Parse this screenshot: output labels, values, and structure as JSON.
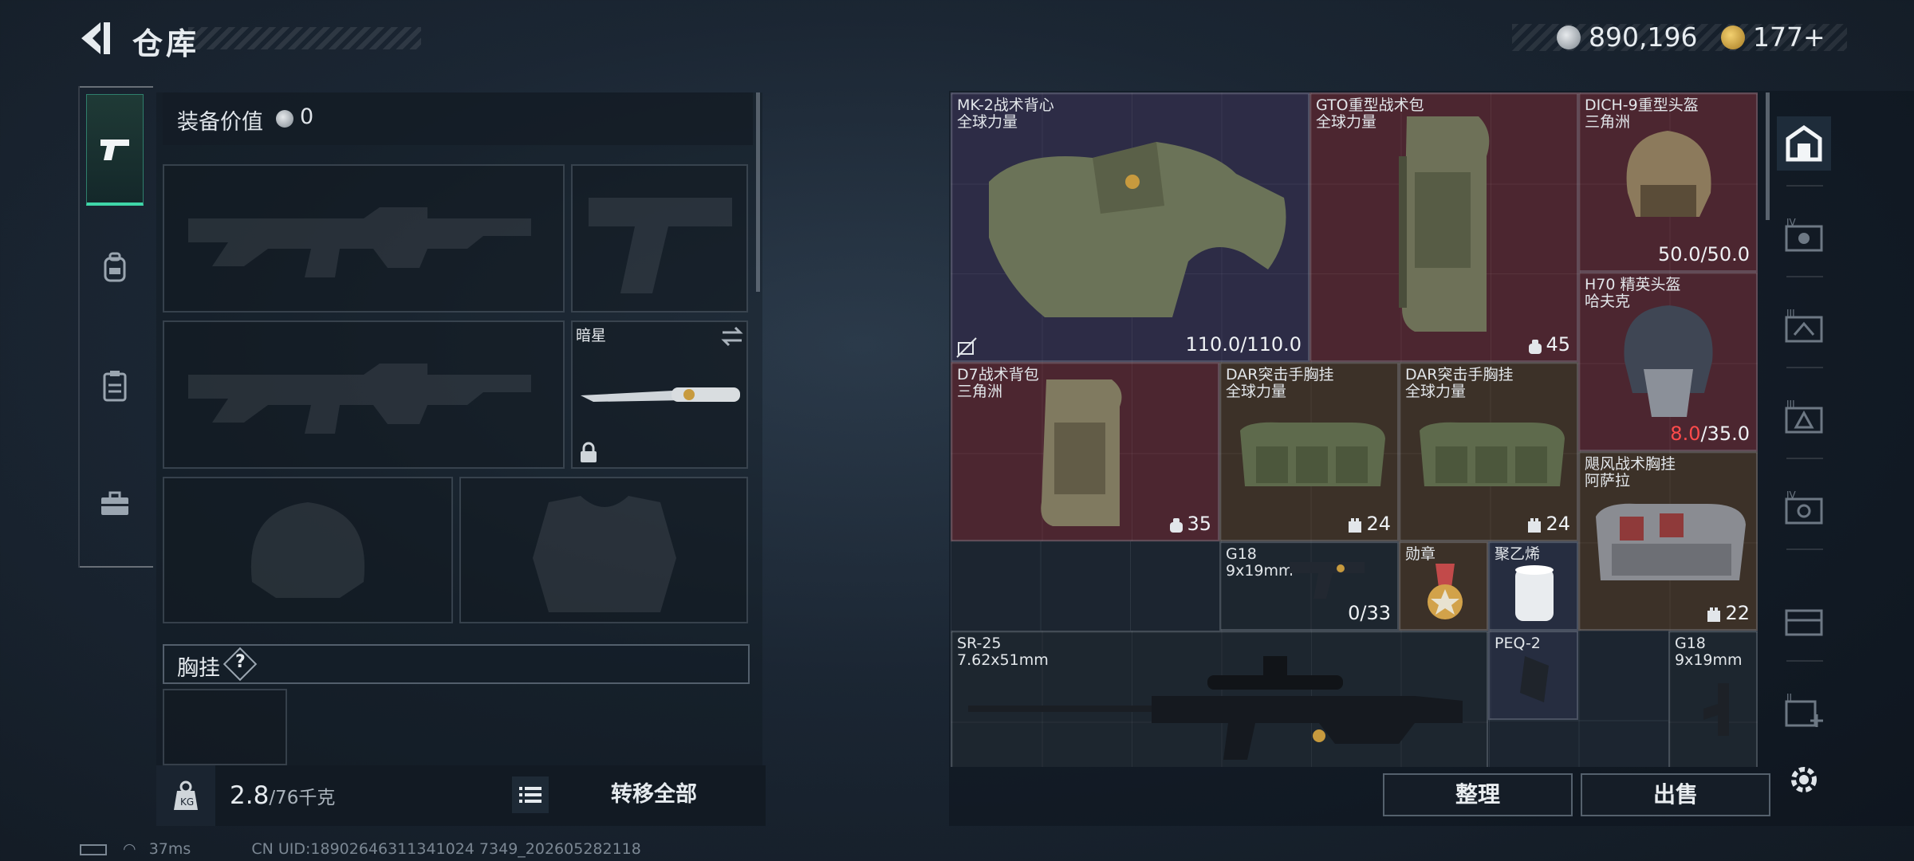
{
  "header": {
    "title": "仓库",
    "silver": "890,196",
    "gold": "177+"
  },
  "left_panel": {
    "value_label": "装备价值",
    "value_amount": "0",
    "knife_name": "暗星",
    "chest_label": "胸挂",
    "help_mark": "?",
    "weight_current": "2.8",
    "weight_capacity": "/76千克",
    "transfer_all": "转移全部"
  },
  "items": [
    {
      "name": "MK-2战术背心",
      "sub": "全球力量",
      "value": "110.0/110.0",
      "rarity": "purple"
    },
    {
      "name": "GTO重型战术包",
      "sub": "全球力量",
      "value": "45",
      "rarity": "red"
    },
    {
      "name": "DICH-9重型头盔",
      "sub": "三角洲",
      "value": "50.0/50.0",
      "rarity": "red"
    },
    {
      "name": "H70 精英头盔",
      "sub": "哈夫克",
      "value_low": "8.0",
      "value_max": "/35.0",
      "rarity": "red"
    },
    {
      "name": "D7战术背包",
      "sub": "三角洲",
      "value": "35",
      "rarity": "red"
    },
    {
      "name": "DAR突击手胸挂",
      "sub": "全球力量",
      "value": "24",
      "rarity": "brown"
    },
    {
      "name": "DAR突击手胸挂",
      "sub": "全球力量",
      "value": "24",
      "rarity": "brown"
    },
    {
      "name": "飓风战术胸挂",
      "sub": "阿萨拉",
      "value": "22",
      "rarity": "brown"
    },
    {
      "name": "G18",
      "sub": "9x19mm",
      "value": "0/33",
      "rarity": "dark"
    },
    {
      "name": "勋章",
      "sub": "",
      "value": "",
      "rarity": "brown"
    },
    {
      "name": "聚乙烯",
      "sub": "",
      "value": "",
      "rarity": "blue"
    },
    {
      "name": "SR-25",
      "sub": "7.62x51mm",
      "value": "",
      "rarity": "dark"
    },
    {
      "name": "PEQ-2",
      "sub": "",
      "value": "",
      "rarity": "blue"
    },
    {
      "name": "G18",
      "sub": "9x19mm",
      "value": "",
      "rarity": "dark"
    }
  ],
  "actions": {
    "sort": "整理",
    "sell": "出售"
  },
  "status": {
    "ping": "37ms",
    "uid": "CN UID:18902646311341024 7349_202605282118"
  },
  "colors": {
    "accent": "#3fd6a8",
    "rarity_red": "#4c2630",
    "rarity_purple": "#2d2c46",
    "rarity_brown": "#3c3128"
  }
}
